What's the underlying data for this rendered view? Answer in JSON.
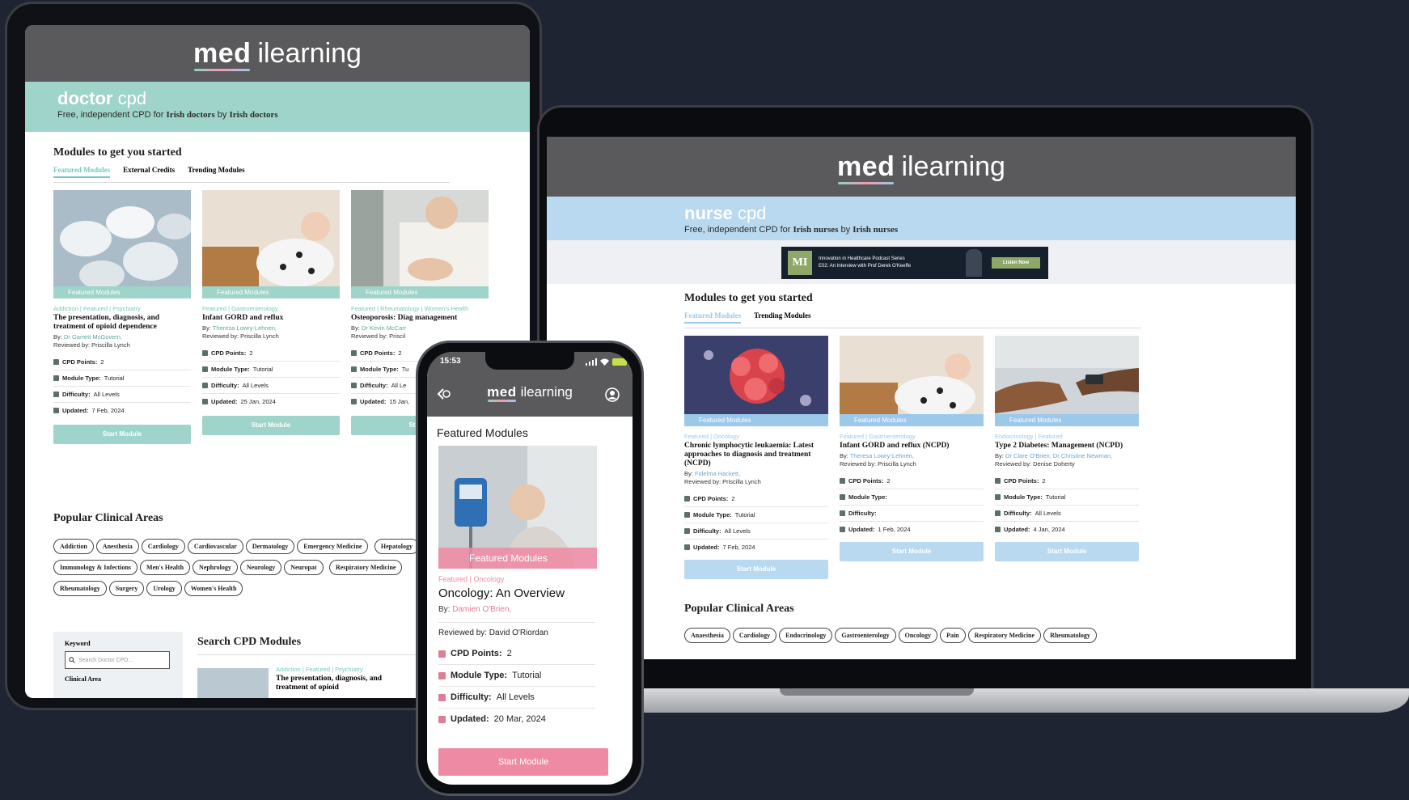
{
  "brand": {
    "logo_bold": "med",
    "logo_rest": "ilearning",
    "teal": "#9ed4c9",
    "blue": "#b8d9ef",
    "pink": "#ee8aa3",
    "dark_bg": "#1f2433"
  },
  "tablet": {
    "band_word1": "doctor",
    "band_word2": "cpd",
    "tagline_pre": "Free, independent CPD for",
    "tagline_b1": "Irish doctors",
    "tagline_mid": "by",
    "tagline_b2": "Irish doctors",
    "section_title": "Modules to get you started",
    "tabs": [
      "Featured Modules",
      "External Credits",
      "Trending Modules"
    ],
    "cards": [
      {
        "ribbon": "Featured Modules",
        "cats": "Addiction | Featured | Psychiatry",
        "title": "The presentation, diagnosis, and treatment of opioid dependence",
        "by_label": "By:",
        "author": "Dr Garrett McGovern,",
        "reviewed": "Reviewed by: Priscilla Lynch",
        "cpd_label": "CPD Points:",
        "cpd": "2",
        "type_label": "Module Type:",
        "type": "Tutorial",
        "diff_label": "Difficulty:",
        "diff": "All Levels",
        "upd_label": "Updated:",
        "upd": "7 Feb, 2024",
        "button": "Start Module"
      },
      {
        "ribbon": "Featured Modules",
        "cats": "Featured | Gastroenterology",
        "title": "Infant GORD and reflux",
        "by_label": "By:",
        "author": "Theresa Lowry-Lehnen,",
        "reviewed": "Reviewed by: Priscilla Lynch",
        "cpd_label": "CPD Points:",
        "cpd": "2",
        "type_label": "Module Type:",
        "type": "Tutorial",
        "diff_label": "Difficulty:",
        "diff": "All Levels",
        "upd_label": "Updated:",
        "upd": "25 Jan, 2024",
        "button": "Start Module"
      },
      {
        "ribbon": "Featured Modules",
        "cats": "Featured | Rheumatology | Women's Health",
        "title": "Osteoporosis: Diag management",
        "by_label": "By:",
        "author": "Dr Kevin McCarr",
        "reviewed": "Reviewed by: Priscil",
        "cpd_label": "CPD Points:",
        "cpd": "2",
        "type_label": "Module Type:",
        "type": "Tu",
        "diff_label": "Difficulty:",
        "diff": "All Le",
        "upd_label": "Updated:",
        "upd": "15 Jan,",
        "button": "Start M"
      }
    ],
    "areas_title": "Popular Clinical Areas",
    "areas": [
      "Addiction",
      "Anesthesia",
      "Cardiology",
      "Cardiovascular",
      "Dermatology",
      "Emergency Medicine",
      "Hepatology",
      "Immunology & Infections",
      "Men's Health",
      "Nephrology",
      "Neurology",
      "Neuropat",
      "Respiratory Medicine",
      "Rheumatology",
      "Surgery",
      "Urology",
      "Women's Health"
    ],
    "keyword_label": "Keyword",
    "search_placeholder": "Search Doctor CPD...",
    "clinical_area_label": "Clinical Area",
    "search_title": "Search CPD Modules",
    "result_cats": "Addiction | Featured | Psychiatry",
    "result_title": "The presentation, diagnosis, and treatment of opioid"
  },
  "laptop": {
    "band_word1": "nurse",
    "band_word2": "cpd",
    "tagline_pre": "Free, independent CPD for",
    "tagline_b1": "Irish nurses",
    "tagline_mid": "by",
    "tagline_b2": "Irish nurses",
    "ad_logo": "MI",
    "ad_line1": "Innovation in Healthcare Podcast Series",
    "ad_line2": "E02: An Interview with Prof Derek O'Keeffe",
    "ad_button": "Listen Now",
    "section_title": "Modules to get you started",
    "tabs": [
      "Featured Modules",
      "Trending Modules"
    ],
    "cards": [
      {
        "ribbon": "Featured Modules",
        "cats": "Featured | Oncology",
        "title": "Chronic lymphocytic leukaemia: Latest approaches to diagnosis and treatment (NCPD)",
        "by_label": "By:",
        "author": "Fidelma Hackett,",
        "reviewed": "Reviewed by: Priscilla Lynch",
        "cpd_label": "CPD Points:",
        "cpd": "2",
        "type_label": "Module Type:",
        "type": "Tutorial",
        "diff_label": "Difficulty:",
        "diff": "All Levels",
        "upd_label": "Updated:",
        "upd": "7 Feb, 2024",
        "button": "Start Module"
      },
      {
        "ribbon": "Featured Modules",
        "cats": "Featured | Gastroenterology",
        "title": "Infant GORD and reflux (NCPD)",
        "by_label": "By:",
        "author": "Theresa Lowry-Lehnen,",
        "reviewed": "Reviewed by: Priscilla Lynch",
        "cpd_label": "CPD Points:",
        "cpd": "2",
        "type_label": "Module Type:",
        "type": "",
        "diff_label": "Difficulty:",
        "diff": "",
        "upd_label": "Updated:",
        "upd": "1 Feb, 2024",
        "button": "Start Module"
      },
      {
        "ribbon": "Featured Modules",
        "cats": "Endocrinology | Featured",
        "title": "Type 2 Diabetes: Management (NCPD)",
        "by_label": "By:",
        "author": "Dr Clare O'Brien, Dr Christine Newman,",
        "reviewed": "Reviewed by: Denise Doherty",
        "cpd_label": "CPD Points:",
        "cpd": "2",
        "type_label": "Module Type:",
        "type": "Tutorial",
        "diff_label": "Difficulty:",
        "diff": "All Levels",
        "upd_label": "Updated:",
        "upd": "4 Jan, 2024",
        "button": "Start Module"
      }
    ],
    "areas_title": "Popular Clinical Areas",
    "areas": [
      "Anaesthesia",
      "Cardiology",
      "Endocrinology",
      "Gastroenterology",
      "Oncology",
      "Pain",
      "Respiratory Medicine",
      "Rheumatology"
    ]
  },
  "phone": {
    "time": "15:53",
    "section_title": "Featured Modules",
    "ribbon": "Featured Modules",
    "cats": "Featured | Oncology",
    "title": "Oncology: An Overview",
    "by_label": "By:",
    "author": "Damien O'Brien,",
    "reviewed": "Reviewed by: David O'Riordan",
    "cpd_label": "CPD Points:",
    "cpd": "2",
    "type_label": "Module Type:",
    "type": "Tutorial",
    "diff_label": "Difficulty:",
    "diff": "All Levels",
    "upd_label": "Updated:",
    "upd": "20 Mar, 2024",
    "button": "Start Module"
  }
}
